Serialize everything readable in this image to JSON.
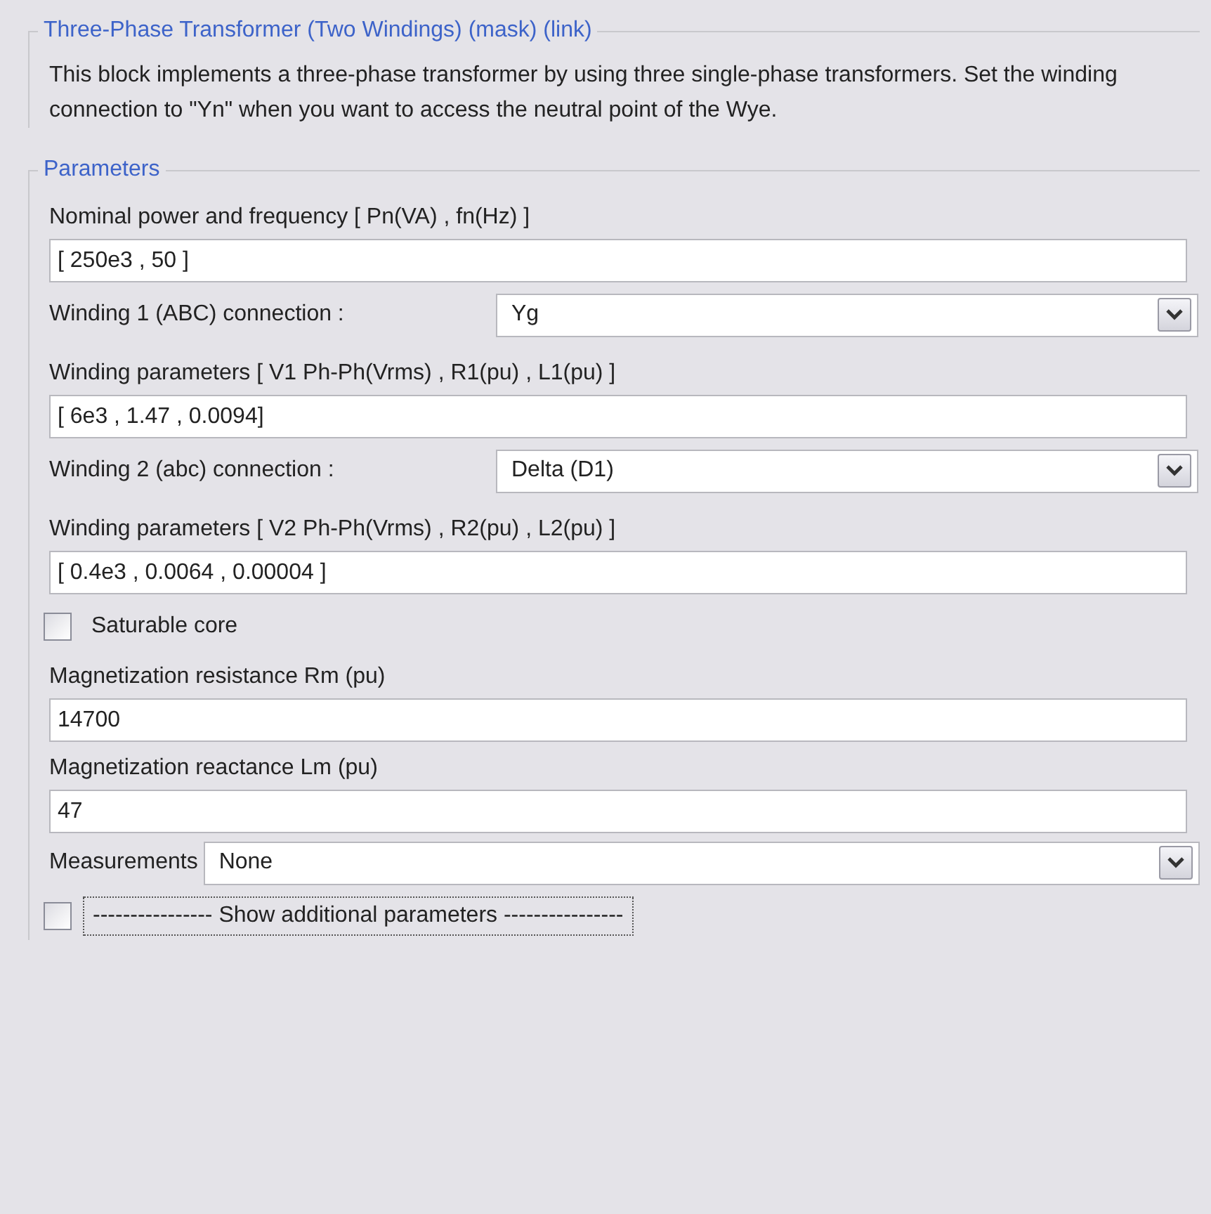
{
  "description_group": {
    "title": "Three-Phase Transformer (Two Windings) (mask) (link)",
    "text": "This block implements a three-phase transformer by using three single-phase transformers. Set the winding connection to \"Yn\"  when you want to access the neutral point of the Wye."
  },
  "parameters_group": {
    "title": "Parameters",
    "items": [
      {
        "kind": "edit",
        "label": "Nominal power and frequency  [ Pn(VA) , fn(Hz) ]",
        "value": "[ 250e3 , 50 ]"
      },
      {
        "kind": "popup",
        "label": "Winding 1 (ABC) connection :",
        "value": "Yg"
      },
      {
        "kind": "edit",
        "label": "Winding parameters [ V1 Ph-Ph(Vrms) , R1(pu) , L1(pu) ]",
        "value": "[ 6e3 , 1.47 , 0.0094]"
      },
      {
        "kind": "popup",
        "label": "Winding 2 (abc) connection :",
        "value": "Delta (D1)"
      },
      {
        "kind": "edit",
        "label": "Winding parameters [ V2 Ph-Ph(Vrms) , R2(pu) , L2(pu) ]",
        "value": "[ 0.4e3 , 0.0064 , 0.00004 ]"
      },
      {
        "kind": "checkbox",
        "label": "Saturable core",
        "checked": false
      },
      {
        "kind": "edit",
        "label": "Magnetization resistance  Rm (pu)",
        "value": "14700"
      },
      {
        "kind": "edit",
        "label": "Magnetization reactance Lm (pu)",
        "value": "47"
      },
      {
        "kind": "popup_inline",
        "label": "Measurements",
        "value": "None"
      },
      {
        "kind": "toggle",
        "label": "---------------- Show additional parameters ----------------",
        "checked": false
      }
    ]
  }
}
